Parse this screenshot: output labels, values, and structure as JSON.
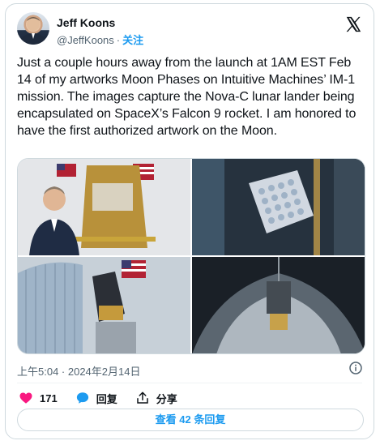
{
  "author": {
    "name": "Jeff Koons",
    "handle": "@JeffKoons",
    "separator": "·",
    "follow_label": "关注"
  },
  "tweet": {
    "text": "Just a couple hours away from the launch at 1AM EST Feb 14 of my artworks Moon Phases on Intuitive Machines’ IM-1 mission. The images capture the Nova-C lunar lander being encapsulated on SpaceX’s Falcon 9 rocket. I am honored to have the first authorized artwork on the Moon.",
    "timestamp": "上午5:04 · 2024年2月14日"
  },
  "actions": {
    "likes_count": "171",
    "reply_label": "回复",
    "share_label": "分享"
  },
  "replies_button_label": "查看 42 条回复",
  "colors": {
    "accent": "#1d9bf0",
    "like": "#f91880",
    "text": "#0f1419",
    "muted": "#536471",
    "border": "#cfd9de"
  },
  "icons": [
    "x-logo-icon",
    "info-icon",
    "heart-icon",
    "reply-icon",
    "share-icon"
  ]
}
